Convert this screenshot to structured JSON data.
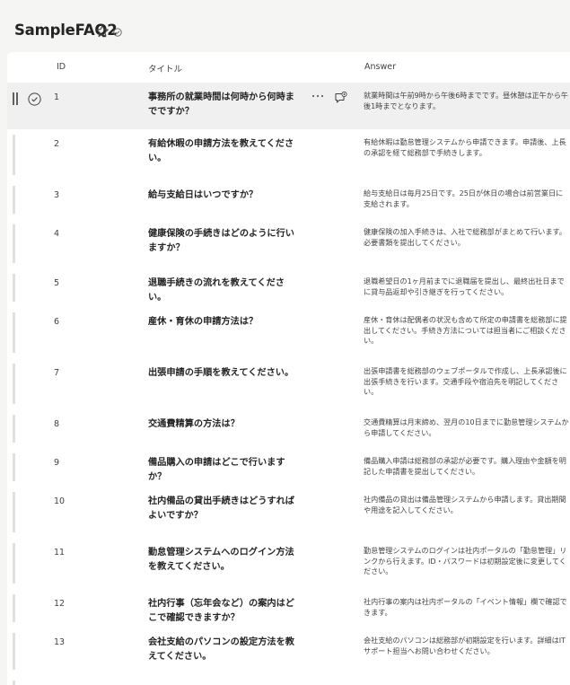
{
  "header": {
    "list_title": "SampleFAQ2"
  },
  "columns": {
    "id": "ID",
    "title": "タイトル",
    "answer": "Answer"
  },
  "rows": [
    {
      "id": "1",
      "title": "事務所の就業時間は何時から何時までですか？",
      "answer": "就業時間は午前9時から午後6時までです。昼休憩は正午から午後1時までとなります。",
      "selected": true
    },
    {
      "id": "2",
      "title": "有給休暇の申請方法を教えてください。",
      "answer": "有給休暇は勤怠管理システムから申請できます。申請後、上長の承認を経て総務部で手続きします。"
    },
    {
      "id": "3",
      "title": "給与支給日はいつですか？",
      "answer": "給与支給日は毎月25日です。25日が休日の場合は前営業日に支給されます。"
    },
    {
      "id": "4",
      "title": "健康保険の手続きはどのように行いますか？",
      "answer": "健康保険の加入手続きは、入社で総務部がまとめて行います。必要書類を提出してください。"
    },
    {
      "id": "5",
      "title": "退職手続きの流れを教えてください。",
      "answer": "退職希望日の1ヶ月前までに退職届を提出し、最終出社日までに貸与品返却や引き継ぎを行ってください。"
    },
    {
      "id": "6",
      "title": "産休・育休の申請方法は？",
      "answer": "産休・育休は配偶者の状況も含めて所定の申請書を総務部に提出してください。手続き方法については担当者にご相談ください。"
    },
    {
      "id": "7",
      "title": "出張申請の手順を教えてください。",
      "answer": "出張申請書を総務部のウェブポータルで作成し、上長承認後に出張手続きを行います。交通手段や宿泊先を明記してください。"
    },
    {
      "id": "8",
      "title": "交通費精算の方法は？",
      "answer": "交通費精算は月末締め、翌月の10日までに勤怠管理システムから申請してください。"
    },
    {
      "id": "9",
      "title": "備品購入の申請はどこで行いますか？",
      "answer": "備品購入申請は総務部の承認が必要です。購入理由や金額を明記した申請書を提出してください。"
    },
    {
      "id": "10",
      "title": "社内備品の貸出手続きはどうすればよいですか？",
      "answer": "社内備品の貸出は備品管理システムから申請します。貸出期間や用途を記入してください。"
    },
    {
      "id": "11",
      "title": "勤怠管理システムへのログイン方法を教えてください。",
      "answer": "勤怠管理システムのログインは社内ポータルの「勤怠管理」リンクから行えます。ID・パスワードは初期設定後に変更してください。"
    },
    {
      "id": "12",
      "title": "社内行事（忘年会など）の案内はどこで確認できますか？",
      "answer": "社内行事の案内は社内ポータルの「イベント情報」欄で確認できます。"
    },
    {
      "id": "13",
      "title": "会社支給のパソコンの設定方法を教えてください。",
      "answer": "会社支給のパソコンは総務部が初期設定を行います。詳細はITサポート担当へお問い合わせください。"
    }
  ]
}
